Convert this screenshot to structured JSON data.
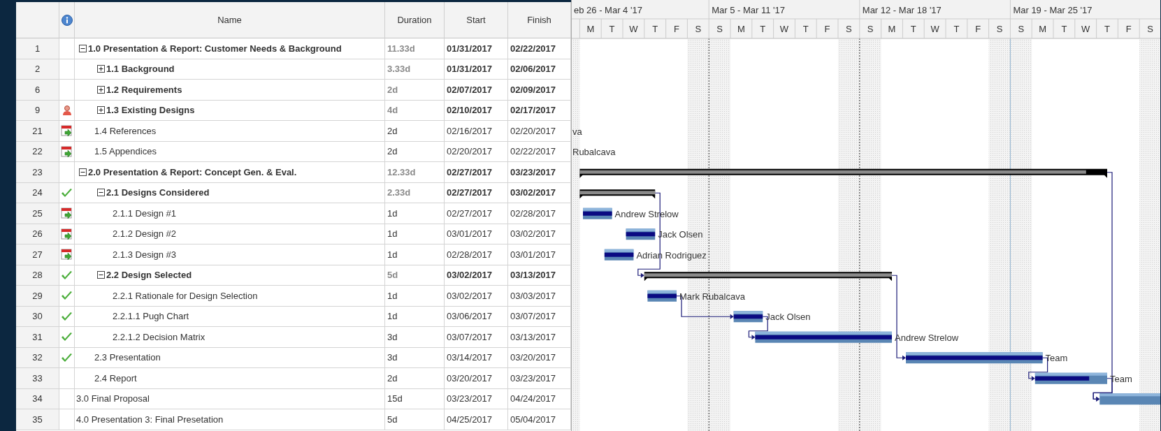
{
  "table": {
    "columns": [
      "Name",
      "Duration",
      "Start",
      "Finish"
    ]
  },
  "rows": [
    {
      "id": "1",
      "kind": "summary",
      "expanded": true,
      "name": "1.0 Presentation & Report: Customer Needs & Background",
      "duration": "11.33d",
      "start": "01/31/2017",
      "finish": "02/22/2017",
      "children": [
        {
          "id": "2",
          "kind": "summary",
          "expanded": false,
          "name": "1.1 Background",
          "duration": "3.33d",
          "start": "01/31/2017",
          "finish": "02/06/2017"
        },
        {
          "id": "6",
          "kind": "summary",
          "expanded": false,
          "name": "1.2 Requirements",
          "duration": "2d",
          "start": "02/07/2017",
          "finish": "02/09/2017"
        },
        {
          "id": "9",
          "kind": "summary",
          "expanded": false,
          "indicator": {
            "kind": "person"
          },
          "name": "1.3 Existing Designs",
          "duration": "4d",
          "start": "02/10/2017",
          "finish": "02/17/2017"
        },
        {
          "id": "21",
          "kind": "task",
          "indicator": {
            "kind": "calendar"
          },
          "name": "1.4 References",
          "duration": "2d",
          "start": "02/16/2017",
          "finish": "02/20/2017",
          "resource": "va"
        },
        {
          "id": "22",
          "kind": "task",
          "indicator": {
            "kind": "calendar"
          },
          "name": "1.5 Appendices",
          "duration": "2d",
          "start": "02/20/2017",
          "finish": "02/22/2017",
          "resource": "Rubalcava"
        }
      ]
    },
    {
      "id": "23",
      "kind": "summary",
      "expanded": true,
      "name": "2.0 Presentation & Report: Concept Gen. & Eval.",
      "duration": "12.33d",
      "start": "02/27/2017",
      "finish": "03/23/2017",
      "level": 0.96,
      "children": [
        {
          "id": "24",
          "kind": "summary",
          "expanded": true,
          "indicator": {
            "kind": "done"
          },
          "name": "2.1 Designs Considered",
          "duration": "2.33d",
          "start": "02/27/2017",
          "finish": "03/02/2017",
          "level": 1,
          "children": [
            {
              "id": "25",
              "kind": "task",
              "indicator": {
                "kind": "calendar"
              },
              "name": "2.1.1 Design #1",
              "duration": "1d",
              "start": "02/27/2017",
              "finish": "02/28/2017",
              "level": 1,
              "resource": "Andrew Strelow"
            },
            {
              "id": "26",
              "kind": "task",
              "indicator": {
                "kind": "calendar"
              },
              "name": "2.1.2 Design #2",
              "duration": "1d",
              "start": "03/01/2017",
              "finish": "03/02/2017",
              "level": 1,
              "resource": "Jack Olsen"
            },
            {
              "id": "27",
              "kind": "task",
              "indicator": {
                "kind": "calendar"
              },
              "name": "2.1.3 Design #3",
              "duration": "1d",
              "start": "02/28/2017",
              "finish": "03/01/2017",
              "level": 1,
              "resource": "Adrian Rodriguez"
            }
          ]
        },
        {
          "id": "28",
          "kind": "summary",
          "expanded": true,
          "indicator": {
            "kind": "done"
          },
          "name": "2.2 Design Selected",
          "duration": "5d",
          "start": "03/02/2017",
          "finish": "03/13/2017",
          "level": 1,
          "children": [
            {
              "id": "29",
              "kind": "task",
              "indicator": {
                "kind": "done"
              },
              "name": "2.2.1 Rationale for Design Selection",
              "duration": "1d",
              "start": "03/02/2017",
              "finish": "03/03/2017",
              "level": 1,
              "resource": "Mark Rubalcava"
            },
            {
              "id": "30",
              "kind": "task",
              "indicator": {
                "kind": "done"
              },
              "name": "2.2.1.1 Pugh Chart",
              "duration": "1d",
              "start": "03/06/2017",
              "finish": "03/07/2017",
              "level": 1,
              "resource": "Jack Olsen"
            },
            {
              "id": "31",
              "kind": "task",
              "indicator": {
                "kind": "done"
              },
              "name": "2.2.1.2 Decision Matrix",
              "duration": "3d",
              "start": "03/07/2017",
              "finish": "03/13/2017",
              "level": 1,
              "resource": "Andrew Strelow"
            }
          ]
        },
        {
          "id": "32",
          "kind": "task",
          "indicator": {
            "kind": "done"
          },
          "name": "2.3 Presentation",
          "duration": "3d",
          "start": "03/14/2017",
          "finish": "03/20/2017",
          "level": 1,
          "resource": "Team"
        },
        {
          "id": "33",
          "kind": "task",
          "name": "2.4 Report",
          "duration": "2d",
          "start": "03/20/2017",
          "finish": "03/23/2017",
          "level": 0.75,
          "resource": "Team"
        }
      ]
    },
    {
      "id": "34",
      "kind": "task",
      "name": "3.0 Final Proposal",
      "duration": "15d",
      "start": "03/23/2017",
      "finish": "04/24/2017"
    },
    {
      "id": "35",
      "kind": "task",
      "name": "4.0 Presentation 3: Final Presetation",
      "duration": "5d",
      "start": "04/25/2017",
      "finish": "05/04/2017"
    }
  ],
  "timeline": {
    "weeks": [
      "eb 26 - Mar 4 '17",
      "Mar 5 - Mar 11 '17",
      "Mar 12 - Mar 18 '17",
      "Mar 19 - Mar 25 '17"
    ],
    "days": [
      {
        "weekend": true
      },
      {
        "label": "M",
        "weekend": false
      },
      {
        "label": "T",
        "weekend": false
      },
      {
        "label": "W",
        "weekend": false
      },
      {
        "label": "T",
        "weekend": false
      },
      {
        "label": "F",
        "weekend": false
      },
      {
        "label": "S",
        "weekend": true
      },
      {
        "label": "S",
        "weekend": true
      },
      {
        "label": "M",
        "weekend": false
      },
      {
        "label": "T",
        "weekend": false
      },
      {
        "label": "W",
        "weekend": false
      },
      {
        "label": "T",
        "weekend": false
      },
      {
        "label": "F",
        "weekend": false
      },
      {
        "label": "S",
        "weekend": true
      },
      {
        "label": "S",
        "weekend": true
      },
      {
        "label": "M",
        "weekend": false
      },
      {
        "label": "T",
        "weekend": false
      },
      {
        "label": "W",
        "weekend": false
      },
      {
        "label": "T",
        "weekend": false
      },
      {
        "label": "F",
        "weekend": false
      },
      {
        "label": "S",
        "weekend": true
      },
      {
        "label": "S",
        "weekend": true
      },
      {
        "label": "M",
        "weekend": false
      },
      {
        "label": "T",
        "weekend": false
      },
      {
        "label": "W",
        "weekend": false
      },
      {
        "label": "T",
        "weekend": false
      },
      {
        "label": "F",
        "weekend": false
      },
      {
        "label": "S",
        "weekend": true
      }
    ]
  }
}
